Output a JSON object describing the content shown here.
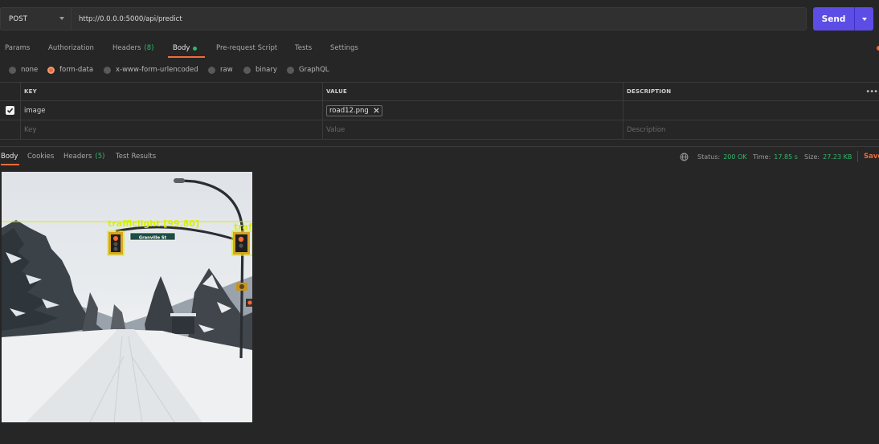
{
  "request": {
    "method": "POST",
    "url": "http://0.0.0.0:5000/api/predict",
    "send_label": "Send"
  },
  "request_tabs": [
    {
      "label": "Params"
    },
    {
      "label": "Authorization"
    },
    {
      "label": "Headers",
      "count": "(8)"
    },
    {
      "label": "Body",
      "active": true
    },
    {
      "label": "Pre-request Script"
    },
    {
      "label": "Tests"
    },
    {
      "label": "Settings"
    }
  ],
  "body_types": [
    {
      "label": "none"
    },
    {
      "label": "form-data",
      "selected": true
    },
    {
      "label": "x-www-form-urlencoded"
    },
    {
      "label": "raw"
    },
    {
      "label": "binary"
    },
    {
      "label": "GraphQL"
    }
  ],
  "params_table": {
    "headers": {
      "key": "KEY",
      "value": "VALUE",
      "description": "DESCRIPTION"
    },
    "rows": [
      {
        "checked": true,
        "key": "image",
        "file": "road12.png",
        "description": ""
      }
    ],
    "placeholders": {
      "key": "Key",
      "value": "Value",
      "description": "Description"
    }
  },
  "response_tabs": [
    {
      "label": "Body",
      "active": true
    },
    {
      "label": "Cookies"
    },
    {
      "label": "Headers",
      "count": "(5)"
    },
    {
      "label": "Test Results"
    }
  ],
  "response_meta": {
    "status_label": "Status:",
    "status_value": "200 OK",
    "time_label": "Time:",
    "time_value": "17.85 s",
    "size_label": "Size:",
    "size_value": "27.23 KB",
    "save_label": "Save"
  },
  "image": {
    "detection_label": "trafficlight [99.80]",
    "detection_label_partial": "traf",
    "street_sign": "Granville St"
  },
  "colors": {
    "accent": "#ef6c3b",
    "send_button": "#5c4de6",
    "success": "#2fb86a",
    "detection": "#d8f000"
  }
}
